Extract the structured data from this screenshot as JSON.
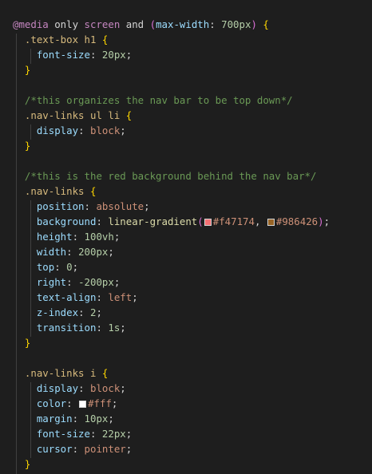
{
  "editor": {
    "colors": {
      "background": "#1e1e1e",
      "gradient_start": "#f47174",
      "gradient_end": "#986426",
      "white": "#ffffff"
    },
    "lines": [
      [
        [
          "at",
          "@media"
        ],
        [
          "text",
          " only "
        ],
        [
          "kw",
          "screen"
        ],
        [
          "text",
          " and "
        ],
        [
          "paren",
          "("
        ],
        [
          "mf",
          "max-width"
        ],
        [
          "punc",
          ": "
        ],
        [
          "num",
          "700px"
        ],
        [
          "paren",
          ")"
        ],
        [
          "text",
          " "
        ],
        [
          "brace",
          "{"
        ]
      ],
      [
        [
          "text",
          "  "
        ],
        [
          "sel",
          ".text-box h1"
        ],
        [
          "text",
          " "
        ],
        [
          "brace",
          "{"
        ]
      ],
      [
        [
          "text",
          "    "
        ],
        [
          "prop",
          "font-size"
        ],
        [
          "punc",
          ": "
        ],
        [
          "num",
          "20px"
        ],
        [
          "punc",
          ";"
        ]
      ],
      [
        [
          "text",
          "  "
        ],
        [
          "brace",
          "}"
        ]
      ],
      [],
      [
        [
          "text",
          "  "
        ],
        [
          "com",
          "/*this organizes the nav bar to be top down*/"
        ]
      ],
      [
        [
          "text",
          "  "
        ],
        [
          "sel",
          ".nav-links ul li"
        ],
        [
          "text",
          " "
        ],
        [
          "brace",
          "{"
        ]
      ],
      [
        [
          "text",
          "    "
        ],
        [
          "prop",
          "display"
        ],
        [
          "punc",
          ": "
        ],
        [
          "val",
          "block"
        ],
        [
          "punc",
          ";"
        ]
      ],
      [
        [
          "text",
          "  "
        ],
        [
          "brace",
          "}"
        ]
      ],
      [],
      [
        [
          "text",
          "  "
        ],
        [
          "com",
          "/*this is the red background behind the nav bar*/"
        ]
      ],
      [
        [
          "text",
          "  "
        ],
        [
          "sel",
          ".nav-links"
        ],
        [
          "text",
          " "
        ],
        [
          "brace",
          "{"
        ]
      ],
      [
        [
          "text",
          "    "
        ],
        [
          "prop",
          "position"
        ],
        [
          "punc",
          ": "
        ],
        [
          "val",
          "absolute"
        ],
        [
          "punc",
          ";"
        ]
      ],
      [
        [
          "text",
          "    "
        ],
        [
          "prop",
          "background"
        ],
        [
          "punc",
          ": "
        ],
        [
          "fn",
          "linear-gradient"
        ],
        [
          "paren",
          "("
        ],
        [
          "swatch",
          "#f47174"
        ],
        [
          "val",
          "#f47174"
        ],
        [
          "punc",
          ", "
        ],
        [
          "swatch",
          "#986426"
        ],
        [
          "val",
          "#986426"
        ],
        [
          "paren",
          ")"
        ],
        [
          "punc",
          ";"
        ]
      ],
      [
        [
          "text",
          "    "
        ],
        [
          "prop",
          "height"
        ],
        [
          "punc",
          ": "
        ],
        [
          "num",
          "100vh"
        ],
        [
          "punc",
          ";"
        ]
      ],
      [
        [
          "text",
          "    "
        ],
        [
          "prop",
          "width"
        ],
        [
          "punc",
          ": "
        ],
        [
          "num",
          "200px"
        ],
        [
          "punc",
          ";"
        ]
      ],
      [
        [
          "text",
          "    "
        ],
        [
          "prop",
          "top"
        ],
        [
          "punc",
          ": "
        ],
        [
          "num",
          "0"
        ],
        [
          "punc",
          ";"
        ]
      ],
      [
        [
          "text",
          "    "
        ],
        [
          "prop",
          "right"
        ],
        [
          "punc",
          ": "
        ],
        [
          "num",
          "-200px"
        ],
        [
          "punc",
          ";"
        ]
      ],
      [
        [
          "text",
          "    "
        ],
        [
          "prop",
          "text-align"
        ],
        [
          "punc",
          ": "
        ],
        [
          "val",
          "left"
        ],
        [
          "punc",
          ";"
        ]
      ],
      [
        [
          "text",
          "    "
        ],
        [
          "prop",
          "z-index"
        ],
        [
          "punc",
          ": "
        ],
        [
          "num",
          "2"
        ],
        [
          "punc",
          ";"
        ]
      ],
      [
        [
          "text",
          "    "
        ],
        [
          "prop",
          "transition"
        ],
        [
          "punc",
          ": "
        ],
        [
          "num",
          "1s"
        ],
        [
          "punc",
          ";"
        ]
      ],
      [
        [
          "text",
          "  "
        ],
        [
          "brace",
          "}"
        ]
      ],
      [],
      [
        [
          "text",
          "  "
        ],
        [
          "sel",
          ".nav-links i"
        ],
        [
          "text",
          " "
        ],
        [
          "brace",
          "{"
        ]
      ],
      [
        [
          "text",
          "    "
        ],
        [
          "prop",
          "display"
        ],
        [
          "punc",
          ": "
        ],
        [
          "val",
          "block"
        ],
        [
          "punc",
          ";"
        ]
      ],
      [
        [
          "text",
          "    "
        ],
        [
          "prop",
          "color"
        ],
        [
          "punc",
          ": "
        ],
        [
          "swatch",
          "#fff"
        ],
        [
          "val",
          "#fff"
        ],
        [
          "punc",
          ";"
        ]
      ],
      [
        [
          "text",
          "    "
        ],
        [
          "prop",
          "margin"
        ],
        [
          "punc",
          ": "
        ],
        [
          "num",
          "10px"
        ],
        [
          "punc",
          ";"
        ]
      ],
      [
        [
          "text",
          "    "
        ],
        [
          "prop",
          "font-size"
        ],
        [
          "punc",
          ": "
        ],
        [
          "num",
          "22px"
        ],
        [
          "punc",
          ";"
        ]
      ],
      [
        [
          "text",
          "    "
        ],
        [
          "prop",
          "cursor"
        ],
        [
          "punc",
          ": "
        ],
        [
          "val",
          "pointer"
        ],
        [
          "punc",
          ";"
        ]
      ],
      [
        [
          "text",
          "  "
        ],
        [
          "brace",
          "}"
        ]
      ]
    ]
  }
}
